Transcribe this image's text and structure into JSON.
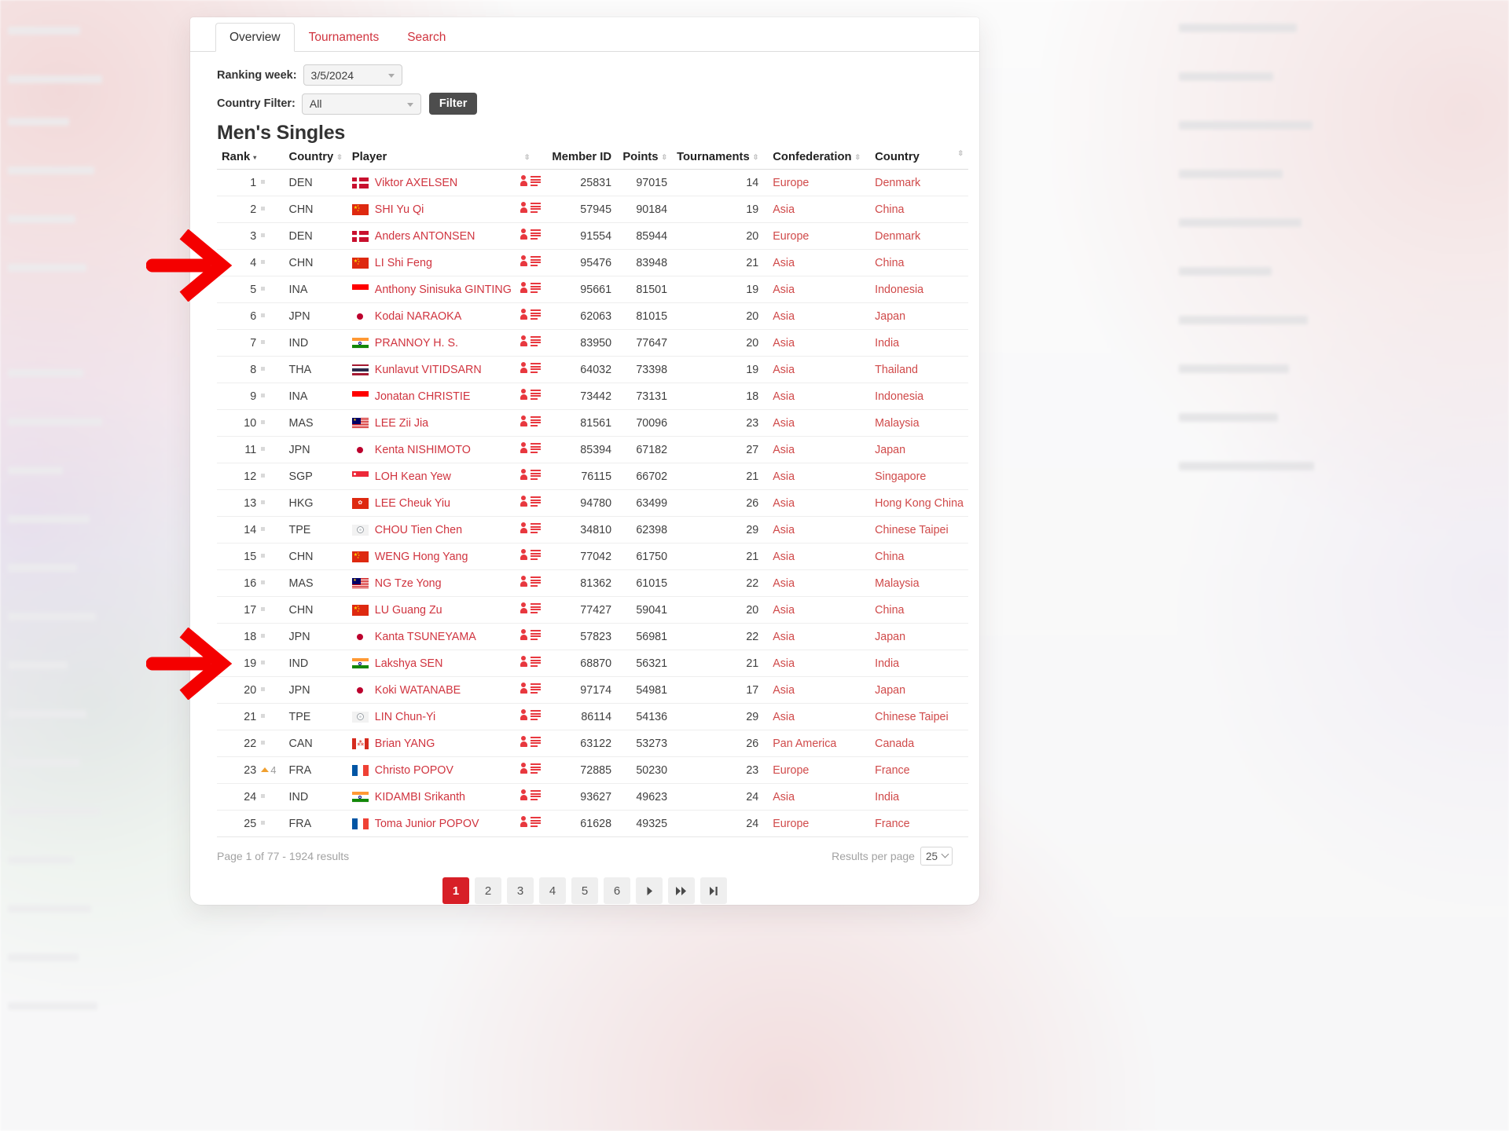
{
  "tabs": [
    {
      "label": "Overview",
      "active": true
    },
    {
      "label": "Tournaments",
      "active": false
    },
    {
      "label": "Search",
      "active": false
    }
  ],
  "filters": {
    "week_label": "Ranking week:",
    "week_value": "3/5/2024",
    "country_label": "Country Filter:",
    "country_value": "All",
    "filter_button": "Filter"
  },
  "category_title": "Men's Singles",
  "columns": {
    "rank": "Rank",
    "country_code": "Country",
    "player": "Player",
    "member_id": "Member ID",
    "points": "Points",
    "tournaments": "Tournaments",
    "confederation": "Confederation",
    "country": "Country"
  },
  "rows": [
    {
      "rank": "1",
      "trend": "dot",
      "trend_num": "",
      "cc": "DEN",
      "flag": "DEN",
      "player": "Viktor AXELSEN",
      "member_id": "25831",
      "points": "97015",
      "tournaments": "14",
      "confederation": "Europe",
      "country": "Denmark"
    },
    {
      "rank": "2",
      "trend": "dot",
      "trend_num": "",
      "cc": "CHN",
      "flag": "CHN",
      "player": "SHI Yu Qi",
      "member_id": "57945",
      "points": "90184",
      "tournaments": "19",
      "confederation": "Asia",
      "country": "China"
    },
    {
      "rank": "3",
      "trend": "dot",
      "trend_num": "",
      "cc": "DEN",
      "flag": "DEN",
      "player": "Anders ANTONSEN",
      "member_id": "91554",
      "points": "85944",
      "tournaments": "20",
      "confederation": "Europe",
      "country": "Denmark"
    },
    {
      "rank": "4",
      "trend": "dot",
      "trend_num": "",
      "cc": "CHN",
      "flag": "CHN",
      "player": "LI Shi Feng",
      "member_id": "95476",
      "points": "83948",
      "tournaments": "21",
      "confederation": "Asia",
      "country": "China"
    },
    {
      "rank": "5",
      "trend": "dot",
      "trend_num": "",
      "cc": "INA",
      "flag": "INA",
      "player": "Anthony Sinisuka GINTING",
      "member_id": "95661",
      "points": "81501",
      "tournaments": "19",
      "confederation": "Asia",
      "country": "Indonesia"
    },
    {
      "rank": "6",
      "trend": "dot",
      "trend_num": "",
      "cc": "JPN",
      "flag": "JPN",
      "player": "Kodai NARAOKA",
      "member_id": "62063",
      "points": "81015",
      "tournaments": "20",
      "confederation": "Asia",
      "country": "Japan"
    },
    {
      "rank": "7",
      "trend": "dot",
      "trend_num": "",
      "cc": "IND",
      "flag": "IND",
      "player": "PRANNOY H. S.",
      "member_id": "83950",
      "points": "77647",
      "tournaments": "20",
      "confederation": "Asia",
      "country": "India"
    },
    {
      "rank": "8",
      "trend": "dot",
      "trend_num": "",
      "cc": "THA",
      "flag": "THA",
      "player": "Kunlavut VITIDSARN",
      "member_id": "64032",
      "points": "73398",
      "tournaments": "19",
      "confederation": "Asia",
      "country": "Thailand"
    },
    {
      "rank": "9",
      "trend": "dot",
      "trend_num": "",
      "cc": "INA",
      "flag": "INA",
      "player": "Jonatan CHRISTIE",
      "member_id": "73442",
      "points": "73131",
      "tournaments": "18",
      "confederation": "Asia",
      "country": "Indonesia"
    },
    {
      "rank": "10",
      "trend": "dot",
      "trend_num": "",
      "cc": "MAS",
      "flag": "MAS",
      "player": "LEE Zii Jia",
      "member_id": "81561",
      "points": "70096",
      "tournaments": "23",
      "confederation": "Asia",
      "country": "Malaysia"
    },
    {
      "rank": "11",
      "trend": "dot",
      "trend_num": "",
      "cc": "JPN",
      "flag": "JPN",
      "player": "Kenta NISHIMOTO",
      "member_id": "85394",
      "points": "67182",
      "tournaments": "27",
      "confederation": "Asia",
      "country": "Japan"
    },
    {
      "rank": "12",
      "trend": "dot",
      "trend_num": "",
      "cc": "SGP",
      "flag": "SGP",
      "player": "LOH Kean Yew",
      "member_id": "76115",
      "points": "66702",
      "tournaments": "21",
      "confederation": "Asia",
      "country": "Singapore"
    },
    {
      "rank": "13",
      "trend": "dot",
      "trend_num": "",
      "cc": "HKG",
      "flag": "HKG",
      "player": "LEE Cheuk Yiu",
      "member_id": "94780",
      "points": "63499",
      "tournaments": "26",
      "confederation": "Asia",
      "country": "Hong Kong China"
    },
    {
      "rank": "14",
      "trend": "dot",
      "trend_num": "",
      "cc": "TPE",
      "flag": "TPE",
      "player": "CHOU Tien Chen",
      "member_id": "34810",
      "points": "62398",
      "tournaments": "29",
      "confederation": "Asia",
      "country": "Chinese Taipei"
    },
    {
      "rank": "15",
      "trend": "dot",
      "trend_num": "",
      "cc": "CHN",
      "flag": "CHN",
      "player": "WENG Hong Yang",
      "member_id": "77042",
      "points": "61750",
      "tournaments": "21",
      "confederation": "Asia",
      "country": "China"
    },
    {
      "rank": "16",
      "trend": "dot",
      "trend_num": "",
      "cc": "MAS",
      "flag": "MAS",
      "player": "NG Tze Yong",
      "member_id": "81362",
      "points": "61015",
      "tournaments": "22",
      "confederation": "Asia",
      "country": "Malaysia"
    },
    {
      "rank": "17",
      "trend": "dot",
      "trend_num": "",
      "cc": "CHN",
      "flag": "CHN",
      "player": "LU Guang Zu",
      "member_id": "77427",
      "points": "59041",
      "tournaments": "20",
      "confederation": "Asia",
      "country": "China"
    },
    {
      "rank": "18",
      "trend": "dot",
      "trend_num": "",
      "cc": "JPN",
      "flag": "JPN",
      "player": "Kanta TSUNEYAMA",
      "member_id": "57823",
      "points": "56981",
      "tournaments": "22",
      "confederation": "Asia",
      "country": "Japan"
    },
    {
      "rank": "19",
      "trend": "dot",
      "trend_num": "",
      "cc": "IND",
      "flag": "IND",
      "player": "Lakshya SEN",
      "member_id": "68870",
      "points": "56321",
      "tournaments": "21",
      "confederation": "Asia",
      "country": "India"
    },
    {
      "rank": "20",
      "trend": "dot",
      "trend_num": "",
      "cc": "JPN",
      "flag": "JPN",
      "player": "Koki WATANABE",
      "member_id": "97174",
      "points": "54981",
      "tournaments": "17",
      "confederation": "Asia",
      "country": "Japan"
    },
    {
      "rank": "21",
      "trend": "dot",
      "trend_num": "",
      "cc": "TPE",
      "flag": "TPE",
      "player": "LIN Chun-Yi",
      "member_id": "86114",
      "points": "54136",
      "tournaments": "29",
      "confederation": "Asia",
      "country": "Chinese Taipei"
    },
    {
      "rank": "22",
      "trend": "dot",
      "trend_num": "",
      "cc": "CAN",
      "flag": "CAN",
      "player": "Brian YANG",
      "member_id": "63122",
      "points": "53273",
      "tournaments": "26",
      "confederation": "Pan America",
      "country": "Canada"
    },
    {
      "rank": "23",
      "trend": "up",
      "trend_num": "4",
      "cc": "FRA",
      "flag": "FRA",
      "player": "Christo POPOV",
      "member_id": "72885",
      "points": "50230",
      "tournaments": "23",
      "confederation": "Europe",
      "country": "France"
    },
    {
      "rank": "24",
      "trend": "dot",
      "trend_num": "",
      "cc": "IND",
      "flag": "IND",
      "player": "KIDAMBI Srikanth",
      "member_id": "93627",
      "points": "49623",
      "tournaments": "24",
      "confederation": "Asia",
      "country": "India"
    },
    {
      "rank": "25",
      "trend": "dot",
      "trend_num": "",
      "cc": "FRA",
      "flag": "FRA",
      "player": "Toma Junior POPOV",
      "member_id": "61628",
      "points": "49325",
      "tournaments": "24",
      "confederation": "Europe",
      "country": "France"
    }
  ],
  "footer": {
    "page_info": "Page 1 of 77 - 1924 results",
    "results_per_page_label": "Results per page",
    "results_per_page_value": "25"
  },
  "pagination": {
    "pages": [
      "1",
      "2",
      "3",
      "4",
      "5",
      "6"
    ],
    "active_page": "1",
    "next_icon": "next-page-icon",
    "fast_forward_icon": "fast-forward-icon",
    "last_icon": "last-page-icon"
  },
  "annotations": {
    "arrow_1_target_rank": "4",
    "arrow_2_target_rank": "19",
    "arrow_color": "#f40000"
  },
  "theme": {
    "accent_red": "#d0343f",
    "active_page_red": "#d71f27",
    "trend_up_orange": "#f0a030"
  }
}
